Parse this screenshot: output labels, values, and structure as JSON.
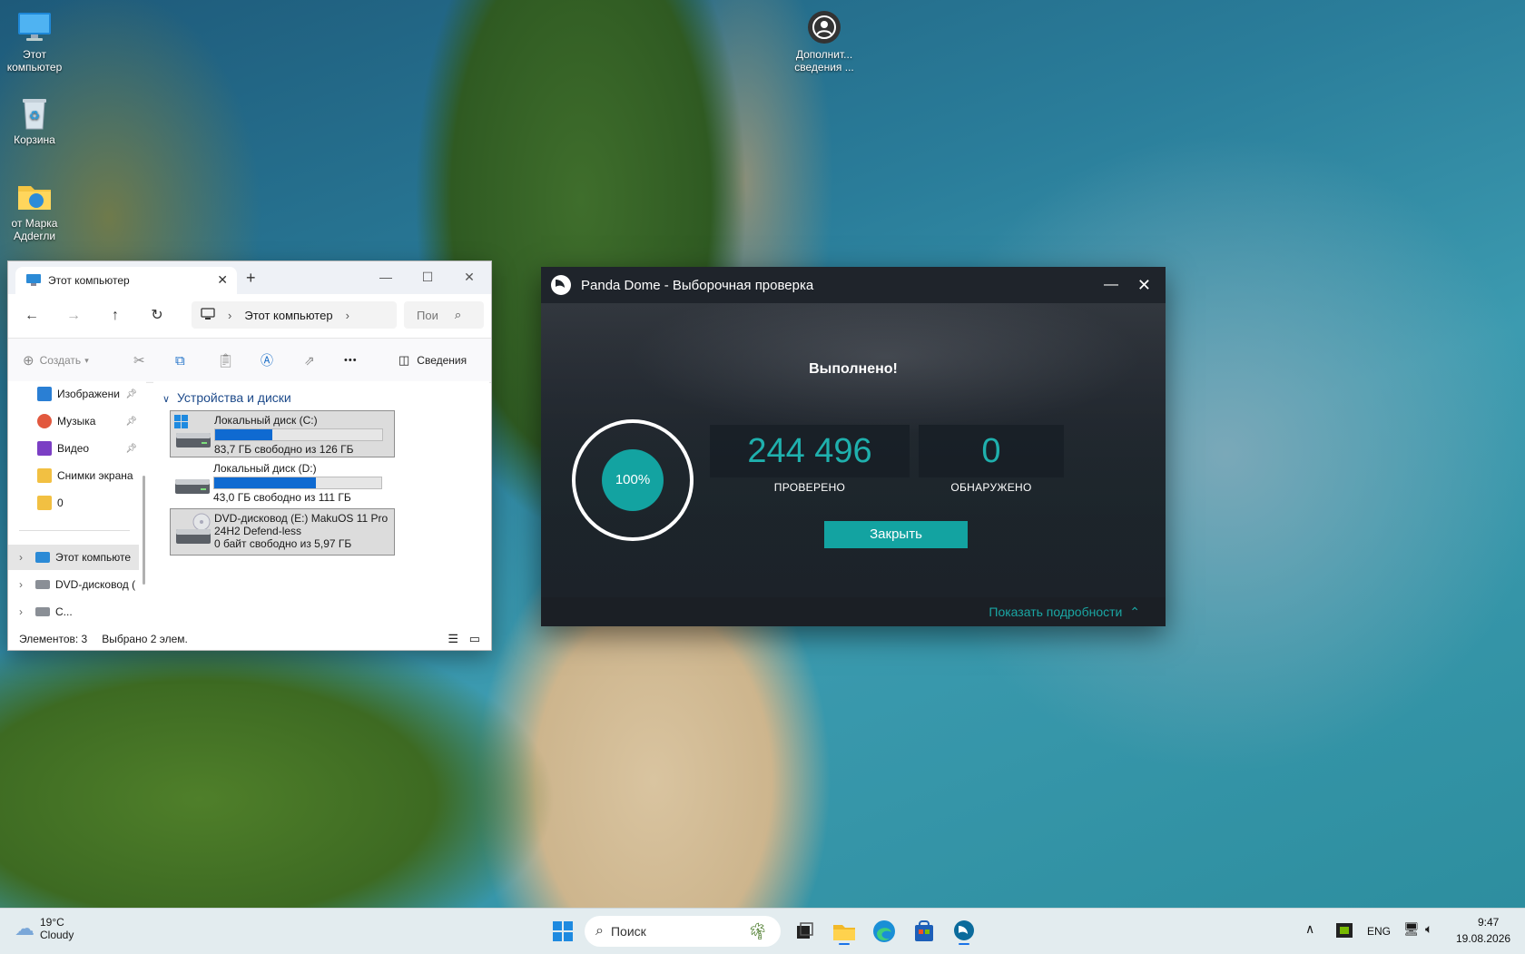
{
  "desktop": {
    "icons": [
      {
        "label": "Этот\nкомпьютер"
      },
      {
        "label": "Корзина"
      },
      {
        "label": "от Марка\nАдderли"
      },
      {
        "label": "Дополнит...\nсведения ..."
      }
    ]
  },
  "explorer": {
    "tab_title": "Этот компьютер",
    "new_tab": "+",
    "breadcrumb": "Этот компьютер",
    "search_placeholder": "Пои",
    "toolbar": {
      "create_label": "Создать",
      "more_label": "•••",
      "details_label": "Сведения"
    },
    "sidebar": {
      "items": [
        {
          "label": "Изображени"
        },
        {
          "label": "Музыка"
        },
        {
          "label": "Видео"
        },
        {
          "label": "Снимки экрана"
        },
        {
          "label": "0"
        },
        {
          "label": "Этот компьюте"
        },
        {
          "label": "DVD-дисковод ("
        },
        {
          "label": "С..."
        }
      ]
    },
    "group_header": "Устройства и диски",
    "drives": [
      {
        "name": "Локальный диск (C:)",
        "free": "83,7 ГБ свободно из 126 ГБ",
        "used_fraction": 0.34
      },
      {
        "name": "Локальный диск (D:)",
        "free": "43,0 ГБ свободно из 111 ГБ",
        "used_fraction": 0.61
      },
      {
        "name": "DVD-дисковод (E:) MakuOS 11 Pro",
        "name2": "24H2 Defend-less",
        "free": "0 байт свободно из 5,97 ГБ"
      }
    ],
    "status": {
      "items": "Элементов: 3",
      "selected": "Выбрано 2 элем."
    }
  },
  "panda": {
    "title": "Panda Dome - Выборочная проверка",
    "done": "Выполнено!",
    "progress": "100%",
    "checked_value": "244 496",
    "checked_label": "ПРОВЕРЕНО",
    "found_value": "0",
    "found_label": "ОБНАРУЖЕНО",
    "close_label": "Закрыть",
    "details_link": "Показать подробности"
  },
  "taskbar": {
    "weather_temp": "19°C",
    "weather_desc": "Cloudy",
    "search_placeholder": "Поиск",
    "lang": "ENG",
    "time": "9:47",
    "date": "19.08.2026"
  },
  "colors": {
    "panda_accent": "#13a3a1",
    "drive_bar": "#0f6ad1"
  }
}
